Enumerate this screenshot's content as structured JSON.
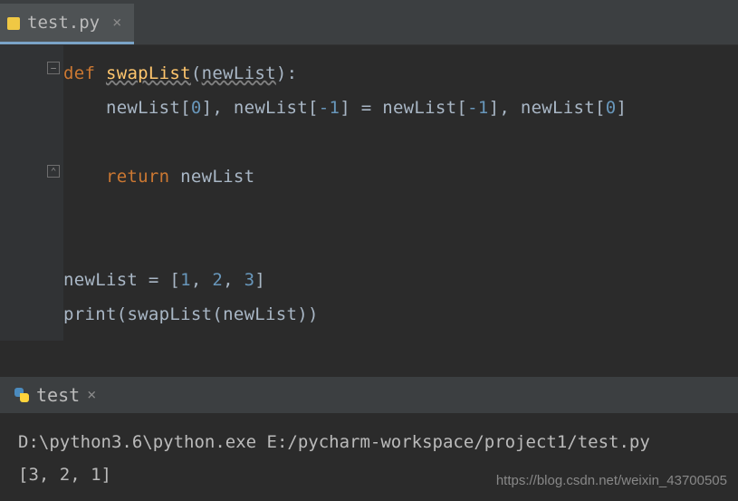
{
  "tab": {
    "filename": "test.py",
    "close_glyph": "×"
  },
  "code": {
    "l1_def": "def ",
    "l1_fn": "swapList",
    "l1_open": "(",
    "l1_param": "newList",
    "l1_close": "):",
    "l2_a": "    newList[",
    "l2_n0a": "0",
    "l2_b": "], newList[",
    "l2_nm1a": "-1",
    "l2_c": "] = newList[",
    "l2_nm1b": "-1",
    "l2_d": "], newList[",
    "l2_n0b": "0",
    "l2_e": "]",
    "l4_ret": "    return ",
    "l4_id": "newList",
    "l7_a": "newList = [",
    "l7_1": "1",
    "l7_c1": ", ",
    "l7_2": "2",
    "l7_c2": ", ",
    "l7_3": "3",
    "l7_b": "]",
    "l8_a": "print",
    "l8_b": "(swapList(newList))"
  },
  "run_tab": {
    "name": "test",
    "close_glyph": "×"
  },
  "console": {
    "line1": "D:\\python3.6\\python.exe E:/pycharm-workspace/project1/test.py",
    "line2": "[3, 2, 1]"
  },
  "watermark": "https://blog.csdn.net/weixin_43700505"
}
